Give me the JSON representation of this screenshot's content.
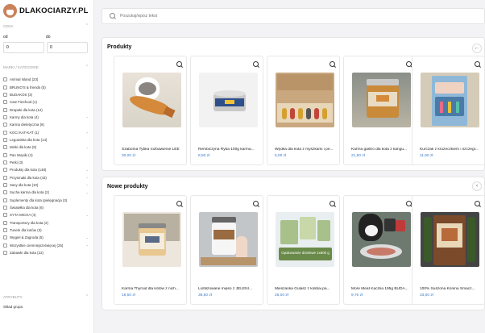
{
  "logo": {
    "text": "DLAKOCIARZY.PL"
  },
  "filters": {
    "price": {
      "title": "CENA",
      "from_label": "od",
      "to_label": "do",
      "from_value": "0",
      "to_value": "0"
    },
    "brands": {
      "title": "MARKI / KATEGORIE",
      "items": [
        {
          "label": "Animal Island (23)",
          "chevron": false
        },
        {
          "label": "BRUNO'S & friends (5)",
          "chevron": false
        },
        {
          "label": "BUDAKOS (3)",
          "chevron": false
        },
        {
          "label": "Catz Finefood (1)",
          "chevron": false
        },
        {
          "label": "Drapaki dla kota (12)",
          "chevron": false
        },
        {
          "label": "Karmy dla kota (4)",
          "chevron": true
        },
        {
          "label": "Karma dietetyczna (6)",
          "chevron": false
        },
        {
          "label": "KOCI KAT-KAT (1)",
          "chevron": true
        },
        {
          "label": "Legowiska dla kota (14)",
          "chevron": false
        },
        {
          "label": "Miski dla kota (9)",
          "chevron": true
        },
        {
          "label": "Pan Wąsiki (4)",
          "chevron": false
        },
        {
          "label": "Petki (3)",
          "chevron": false
        },
        {
          "label": "Produkty dla kota (148)",
          "chevron": true
        },
        {
          "label": "Przysmaki dla kota (43)",
          "chevron": true
        },
        {
          "label": "Sasy dla kota (10)",
          "chevron": true
        },
        {
          "label": "Sucha karma dla kota (2)",
          "chevron": true
        },
        {
          "label": "Suplementy dla kota (pielęgnacja (3)",
          "chevron": false
        },
        {
          "label": "Światełka dla kota (6)",
          "chevron": false
        },
        {
          "label": "SYTA MICHA (4)",
          "chevron": true
        },
        {
          "label": "Transportery dla kota (2)",
          "chevron": false
        },
        {
          "label": "Tunele dla kotów (3)",
          "chevron": false
        },
        {
          "label": "Węgiel & Zagroda (5)",
          "chevron": true
        },
        {
          "label": "Wszystkie ciemniejsze/więcej (25)",
          "chevron": true
        },
        {
          "label": "Zabawki dla kota (22)",
          "chevron": false
        }
      ]
    },
    "attributes": {
      "title": "ATRYBUTY",
      "value": "Skład grupa"
    }
  },
  "search": {
    "placeholder": "Poszukaj/wpisz tekst"
  },
  "sections": [
    {
      "title": "Produkty",
      "products": [
        {
          "name": "Szaboma Tybka rozbawienie LEE",
          "price": "30,00 zł"
        },
        {
          "name": "Rembiczyna Ryba 100g karma...",
          "price": "8,50 zł"
        },
        {
          "name": "Wędka dla kota z myszkami i pe...",
          "price": "6,00 zł"
        },
        {
          "name": "Karma gastro dla kota z kangu...",
          "price": "21,50 zł"
        },
        {
          "name": "Kurczak z krużeczkiem i szczegr...",
          "price": "11,90 zł"
        }
      ]
    },
    {
      "title": "Nowe produkty",
      "products": [
        {
          "name": "Karma Thyroid dla kotów z nich...",
          "price": "18,50 zł"
        },
        {
          "name": "Liofilizowane mięso z JELENI...",
          "price": "38,50 zł"
        },
        {
          "name": "Mieszanka Gulasz z kolibai pa...",
          "price": "25,00 zł"
        },
        {
          "name": "More Meat Kaczka 195g BUDA...",
          "price": "9,70 zł"
        },
        {
          "name": "100% Suszona Konina Smacz...",
          "price": "33,00 zł"
        }
      ],
      "badge": "Opakowanie dziełowe 1x600 g"
    }
  ],
  "icons": [
    "logo-icon",
    "search-icon",
    "zoom-icon",
    "chevron-down-icon",
    "arrow-left-icon"
  ]
}
